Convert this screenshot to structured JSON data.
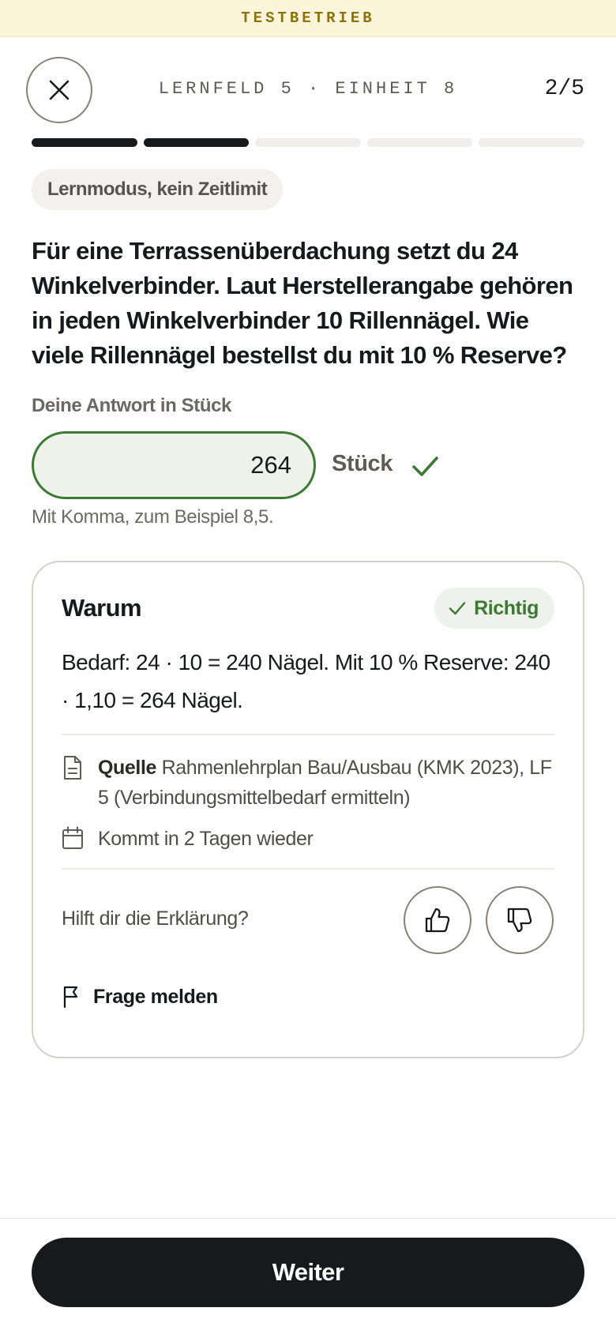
{
  "banner": {
    "text": "TESTBETRIEB"
  },
  "header": {
    "close_icon": "close-icon",
    "title": "LERNFELD 5 · EINHEIT 8",
    "counter": "2/5"
  },
  "progress": {
    "total": 5,
    "completed": 2
  },
  "mode_pill": "Lernmodus, kein Zeitlimit",
  "question": "Für eine Terrassenüberdachung setzt du 24 Winkelverbinder. Laut Herstellerangabe gehören in jeden Winkelverbinder 10 Rillennägel. Wie viele Rillennägel bestellst du mit 10 % Reserve?",
  "answer": {
    "label": "Deine Antwort in Stück",
    "value": "264",
    "unit": "Stück",
    "hint": "Mit Komma, zum Beispiel 8,5."
  },
  "explanation_card": {
    "title": "Warum",
    "result_badge": "Richtig",
    "text": "Bedarf: 24 · 10 = 240 Nägel. Mit 10 % Reserve: 240 · 1,10 = 264 Nägel.",
    "source_label": "Quelle",
    "source_text": "Rahmenlehrplan Bau/Ausbau (KMK 2023), LF 5 (Verbindungsmittelbedarf ermitteln)",
    "review_text": "Kommt in 2 Tagen wieder",
    "feedback_question": "Hilft dir die Erklärung?",
    "report_label": "Frage melden"
  },
  "footer": {
    "next_label": "Weiter"
  },
  "colors": {
    "banner_bg": "#fcf5d9",
    "accent_green": "#3c7a31",
    "primary_dark": "#17191c"
  }
}
